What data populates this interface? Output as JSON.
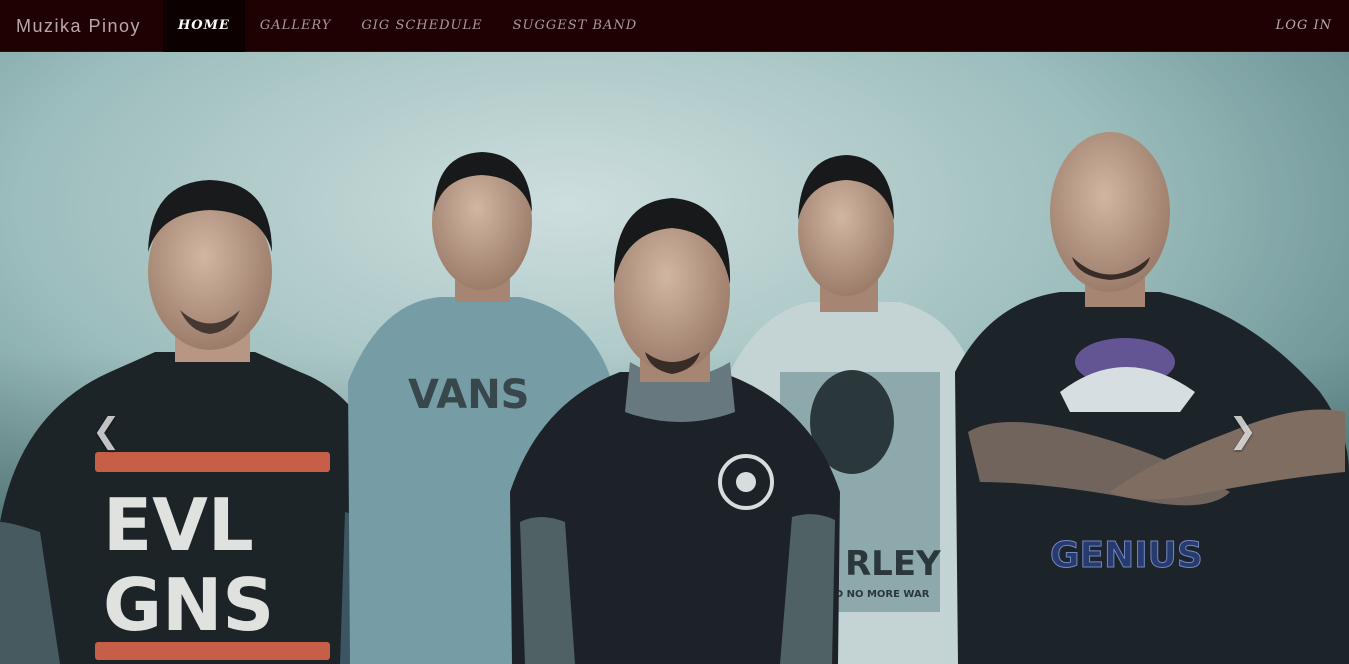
{
  "navbar": {
    "brand": "Muzika Pinoy",
    "items": [
      {
        "label": "HOME",
        "active": true
      },
      {
        "label": "GALLERY",
        "active": false
      },
      {
        "label": "GIG SCHEDULE",
        "active": false
      },
      {
        "label": "SUGGEST BAND",
        "active": false
      }
    ],
    "login_label": "LOG IN"
  },
  "carousel": {
    "slide_description": "band photo",
    "shirt_texts": [
      "EVL GNS",
      "VANS",
      "RLEY",
      "ED NO MORE WAR",
      "GENIUS"
    ],
    "prev_icon": "chevron-left-icon",
    "next_icon": "chevron-right-icon"
  },
  "colors": {
    "navbar_bg": "#1f0003",
    "active_bg": "#0d0000",
    "backdrop": "#8fb8b6"
  }
}
